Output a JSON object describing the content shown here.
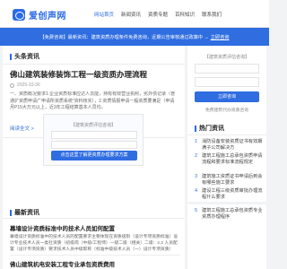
{
  "header": {
    "logo_text": "爱创声网",
    "nav": [
      "网站首页",
      "新闻资讯",
      "资质专题",
      "百科知识",
      "联系我们"
    ]
  },
  "banner": {
    "text": "【免费咨询】最新资讯：建筑资质办理条件免费咨询，近期公告审核通过政策中 → ",
    "cta": "立即咨询"
  },
  "main": {
    "section_title": "头条资讯",
    "article": {
      "title": "佛山建筑装修装饰工程一级资质办理流程",
      "date": "2025-10-30",
      "body": "一、资质概况要求1.企业资质标准应达人员能，持有有效营业执照，劣外债记录（普通扩资质申请广申请所资质系统“资料核实），2.资质情报申请一般资质要满足（申请月P15大万元以上，近3年工程结算基本人员均。",
      "readmore": "阅读全文 >"
    },
    "consult": {
      "label": "【建筑资质评估咨询】",
      "button": "点击这里了解更资质办理要求方案"
    }
  },
  "side": {
    "consult_label": "【建筑资质评估咨询】",
    "button": "立即咨询",
    "foot": "免费建筑代办资质咨询",
    "hot_title": "热门资讯",
    "hot": [
      {
        "num": "1",
        "text": "消防设备安装资质证书有效期满子公司解决方"
      },
      {
        "num": "2",
        "text": "建筑工程施工总承包资质申请流程和要求标准流程规定"
      },
      {
        "num": "3",
        "text": "建筑施工资质证书申请后到会有哪些施工要求"
      },
      {
        "num": "4",
        "text": "建设工程三级资质审批办理流程什么要求"
      },
      {
        "num": "5",
        "text": "建筑工程施工总承包资质专业资质办理程序"
      }
    ]
  },
  "latest": {
    "section_title": "最新资讯",
    "items": [
      {
        "title": "幕墙设计资质标准中的技术人员如何配置",
        "body": "幕墙设计资质标准中的技术人员的配置要求主要体现在资质级别（设计专项资质标准）设计专业技术人员一类社资质（初级岗（中级/工程师）一级二级（相关）二级：2.2 人员配置（设计专项资质）要求技术人员中级职称（标准中级技术人员（一）设计专项资质）"
      },
      {
        "title": "佛山建筑机电安装工程专业承包资质费用"
      }
    ]
  }
}
